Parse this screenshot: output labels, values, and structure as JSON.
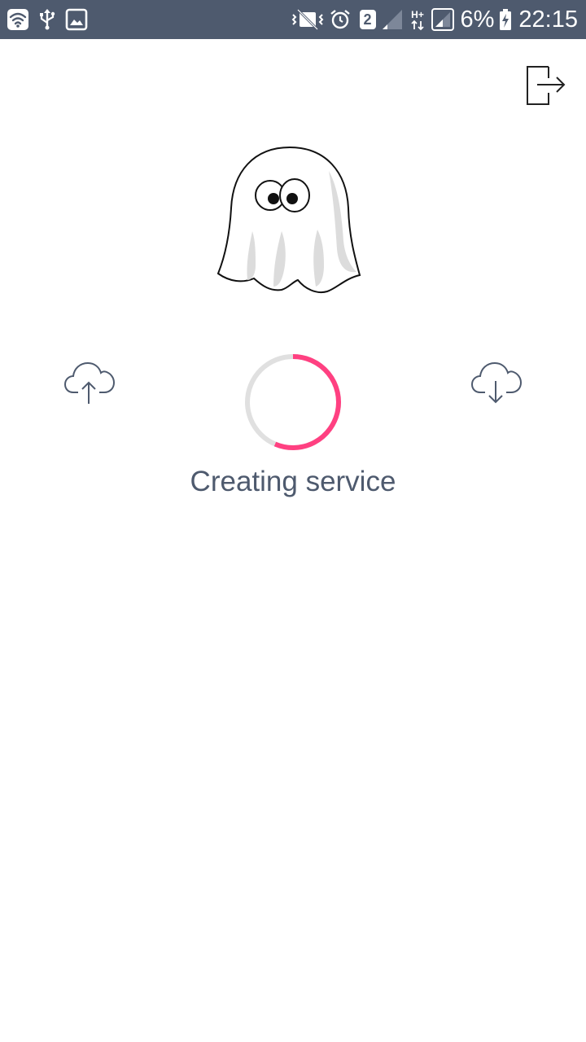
{
  "status_bar": {
    "battery_percent": "6%",
    "time": "22:15",
    "sim_slot": "2",
    "network_type": "H+",
    "icons": [
      "wifi-icon",
      "usb-icon",
      "image-icon",
      "vibrate-icon",
      "alarm-icon",
      "sim-icon",
      "signal-icon",
      "data-arrows-icon",
      "signal-icon",
      "battery-charging-icon"
    ],
    "background_color": "#4e5a6e"
  },
  "toolbar": {
    "exit_icon": "exit-icon"
  },
  "main": {
    "mascot": "ghost-icon",
    "upload_icon": "cloud-upload-icon",
    "download_icon": "cloud-download-icon",
    "status_text": "Creating service",
    "spinner_color": "#ff4081",
    "spinner_track_color": "#e0e0e0",
    "text_color": "#4e5a6e"
  }
}
